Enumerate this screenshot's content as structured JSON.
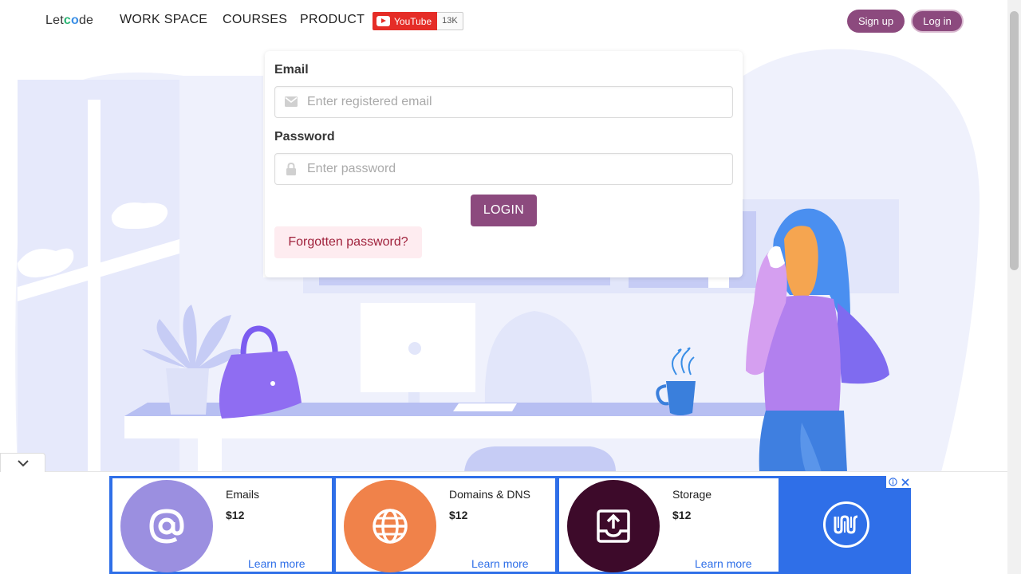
{
  "brand": {
    "logo_pre": "Let",
    "logo_c": "c",
    "logo_o": "o",
    "logo_post": "de"
  },
  "nav": {
    "items": [
      "WORK SPACE",
      "COURSES",
      "PRODUCT"
    ],
    "youtube_label": "YouTube",
    "youtube_count": "13K",
    "signup_label": "Sign up",
    "login_label": "Log in"
  },
  "form": {
    "email_label": "Email",
    "email_placeholder": "Enter registered email",
    "email_value": "",
    "password_label": "Password",
    "password_placeholder": "Enter password",
    "password_value": "",
    "login_button": "LOGIN",
    "forgot_button": "Forgotten password?"
  },
  "ads": {
    "items": [
      {
        "title": "Emails",
        "price": "$12",
        "link": "Learn more",
        "icon": "at-sign-icon",
        "color": "#9b8fe0"
      },
      {
        "title": "Domains & DNS",
        "price": "$12",
        "link": "Learn more",
        "icon": "globe-icon",
        "color": "#f0824a"
      },
      {
        "title": "Storage",
        "price": "$12",
        "link": "Learn more",
        "icon": "upload-tray-icon",
        "color": "#3d0a2a"
      }
    ],
    "brand_color": "#2f6fe8",
    "info_icon": "info-icon",
    "close_icon": "close-icon"
  },
  "colors": {
    "accent": "#8c4a7e",
    "forgot_bg": "#feecf0"
  }
}
